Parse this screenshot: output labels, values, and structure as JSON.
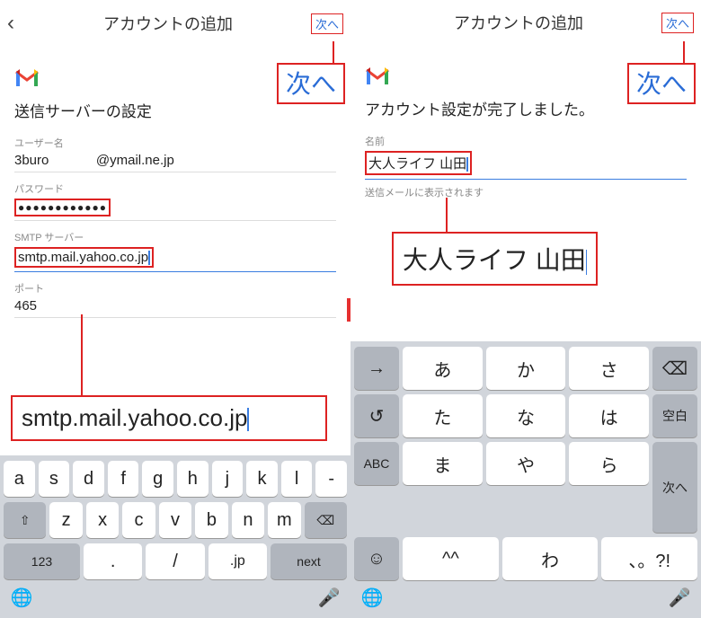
{
  "left": {
    "header_title": "アカウントの追加",
    "next_small": "次へ",
    "next_big": "次へ",
    "subtitle": "送信サーバーの設定",
    "username_label": "ユーザー名",
    "username_value_prefix": "3buro",
    "username_value_suffix": "@ymail.ne.jp",
    "password_label": "パスワード",
    "password_value": "●●●●●●●●●●●●",
    "smtp_label": "SMTP サーバー",
    "smtp_value": "smtp.mail.yahoo.co.jp",
    "port_label": "ポート",
    "port_value": "465",
    "callout": "smtp.mail.yahoo.co.jp",
    "keyboard": {
      "row1": [
        "a",
        "s",
        "d",
        "f",
        "g",
        "h",
        "j",
        "k",
        "l",
        "-"
      ],
      "row2": [
        "z",
        "x",
        "c",
        "v",
        "b",
        "n",
        "m"
      ],
      "row3_left": "123",
      "row3_dot": ".",
      "row3_slash": "/",
      "row3_jp": ".jp",
      "row3_next": "next"
    }
  },
  "right": {
    "header_title": "アカウントの追加",
    "next_small": "次へ",
    "next_big": "次へ",
    "subtitle": "アカウント設定が完了しました。",
    "name_label": "名前",
    "name_value": "大人ライフ 山田",
    "hint": "送信メールに表示されます",
    "callout": "大人ライフ 山田",
    "keyboard": {
      "rows": [
        [
          "→",
          "あ",
          "か",
          "さ",
          "⌫"
        ],
        [
          "↺",
          "た",
          "な",
          "は",
          "空白"
        ],
        [
          "ABC",
          "ま",
          "や",
          "ら",
          "次へ"
        ],
        [
          "☺",
          "^^",
          "わ",
          "、。?!",
          ""
        ]
      ]
    }
  }
}
